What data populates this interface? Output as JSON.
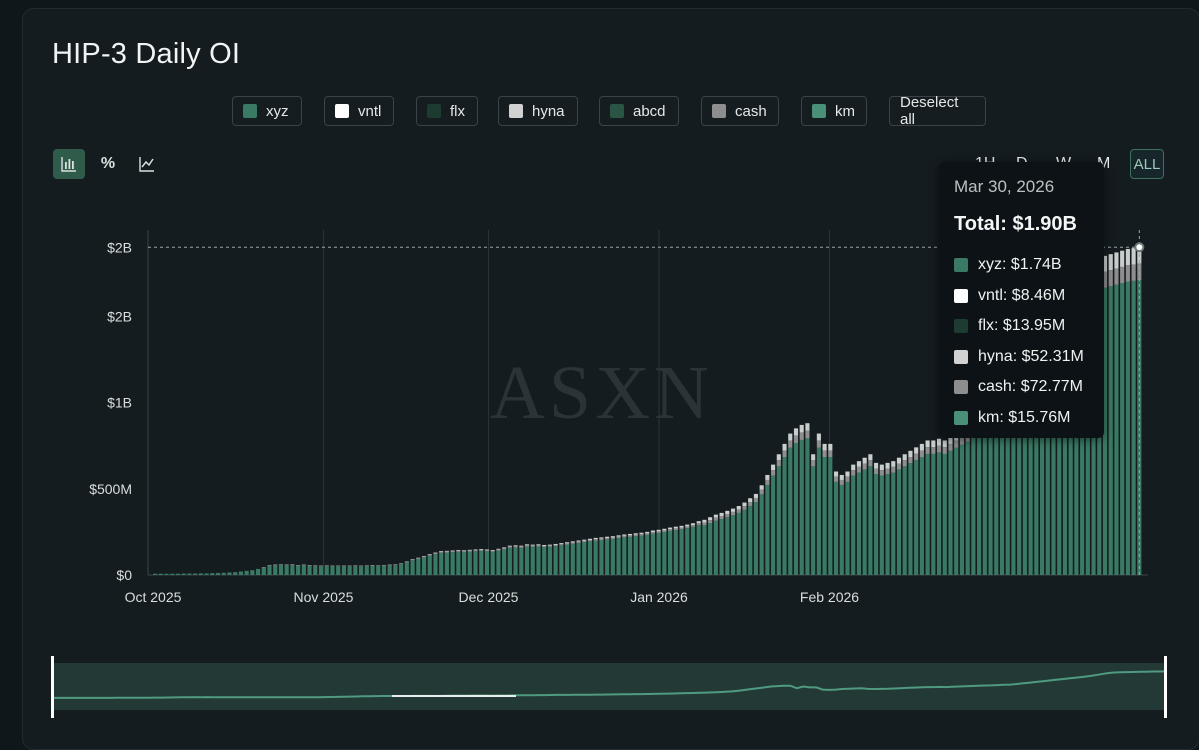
{
  "title": "HIP-3 Daily OI",
  "watermark": "ASXN",
  "legend": [
    {
      "label": "xyz",
      "color": "#3a7a64"
    },
    {
      "label": "vntl",
      "color": "#ffffff"
    },
    {
      "label": "flx",
      "color": "#1d3b31"
    },
    {
      "label": "hyna",
      "color": "#d2d2d2"
    },
    {
      "label": "abcd",
      "color": "#2a5545"
    },
    {
      "label": "cash",
      "color": "#8e8e8e"
    },
    {
      "label": "km",
      "color": "#4a8f78"
    }
  ],
  "deselect_label": "Deselect all",
  "modes": [
    {
      "name": "bar-chart-icon",
      "glyph": "bar"
    },
    {
      "name": "percent-icon",
      "glyph": "%"
    },
    {
      "name": "line-chart-icon",
      "glyph": "line"
    }
  ],
  "range_buttons": [
    "1H",
    "D",
    "W",
    "M",
    "ALL"
  ],
  "active_range": "ALL",
  "tooltip": {
    "date": "Mar 30, 2026",
    "total": "Total: $1.90B",
    "rows": [
      {
        "label": "xyz: $1.74B",
        "color": "#3a7a64"
      },
      {
        "label": "vntl: $8.46M",
        "color": "#ffffff"
      },
      {
        "label": "flx: $13.95M",
        "color": "#1d3b31"
      },
      {
        "label": "hyna: $52.31M",
        "color": "#d2d2d2"
      },
      {
        "label": "cash: $72.77M",
        "color": "#8e8e8e"
      },
      {
        "label": "km: $15.76M",
        "color": "#4a8f78"
      }
    ]
  },
  "chart_data": {
    "type": "bar",
    "stacked": true,
    "xlabel": "",
    "ylabel": "",
    "x_ticks": [
      "Oct 2025",
      "Nov 2025",
      "Dec 2025",
      "Jan 2026",
      "Feb 2026"
    ],
    "y_ticks": [
      "$0",
      "$500M",
      "$1B",
      "$2B",
      "$2B"
    ],
    "y_tick_values": [
      0,
      500,
      1000,
      1500,
      1900
    ],
    "ylim": [
      0,
      2000
    ],
    "units": "millions USD",
    "grid": "vertical at month starts",
    "x_start": "2025-10-01",
    "x_end": "2026-03-30",
    "highlight": {
      "date": "2026-03-30",
      "total": 1900
    },
    "totals_millions": [
      8,
      8,
      8,
      8,
      8,
      9,
      9,
      9,
      10,
      10,
      12,
      13,
      14,
      16,
      18,
      22,
      26,
      30,
      38,
      45,
      58,
      60,
      62,
      60,
      62,
      58,
      60,
      58,
      56,
      55,
      56,
      54,
      55,
      54,
      55,
      56,
      55,
      56,
      57,
      56,
      58,
      60,
      62,
      68,
      78,
      92,
      100,
      110,
      120,
      130,
      138,
      140,
      142,
      145,
      143,
      146,
      148,
      150,
      148,
      145,
      152,
      160,
      170,
      172,
      170,
      178,
      176,
      178,
      174,
      176,
      180,
      185,
      190,
      195,
      200,
      205,
      210,
      215,
      218,
      222,
      225,
      230,
      235,
      238,
      242,
      245,
      250,
      258,
      262,
      268,
      275,
      280,
      285,
      292,
      300,
      312,
      320,
      335,
      350,
      360,
      372,
      385,
      400,
      420,
      445,
      470,
      520,
      580,
      640,
      700,
      760,
      820,
      850,
      870,
      880,
      700,
      820,
      760,
      760,
      600,
      580,
      600,
      640,
      660,
      680,
      700,
      650,
      640,
      650,
      660,
      680,
      700,
      720,
      740,
      760,
      780,
      780,
      790,
      780,
      800,
      820,
      840,
      860,
      880,
      890,
      900,
      920,
      940,
      960,
      1000,
      1050,
      1100,
      1150,
      1200,
      1250,
      1300,
      1350,
      1400,
      1450,
      1500,
      1560,
      1620,
      1700,
      1780,
      1820,
      1840,
      1850,
      1860,
      1870,
      1880,
      1890,
      1895,
      1900
    ],
    "cap_fraction_note": "top of each bar is a stack of smaller grey/white segments above the green xyz base"
  },
  "navigator": {
    "label": ""
  }
}
